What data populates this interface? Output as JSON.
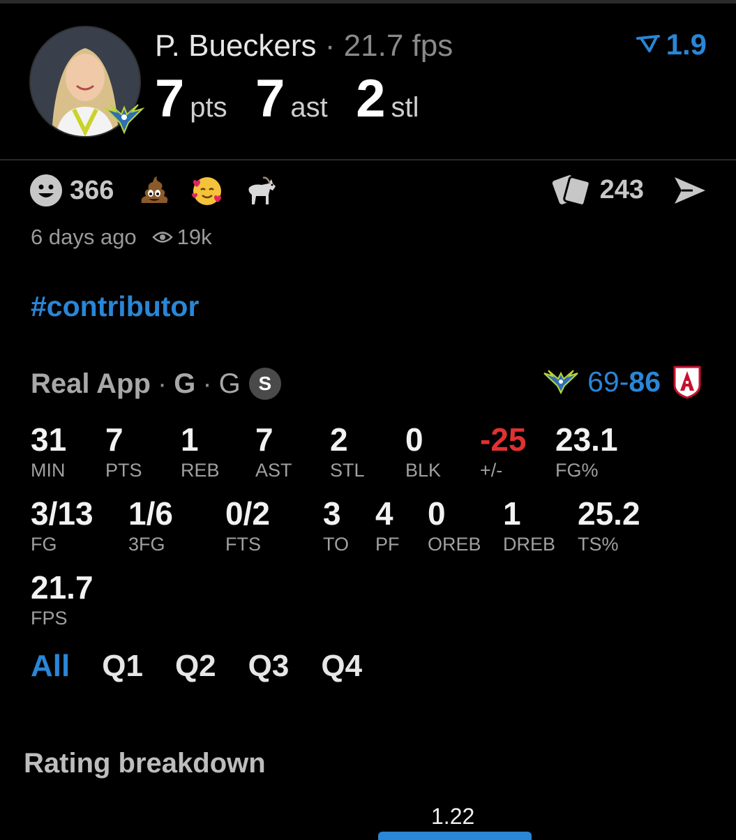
{
  "header": {
    "player_name": "P. Bueckers",
    "separator": "·",
    "fps_text": "21.7 fps",
    "vote_value": "1.9",
    "vote_icon": "chevron-down-icon",
    "stats": [
      {
        "value": "7",
        "unit": "pts"
      },
      {
        "value": "7",
        "unit": "ast"
      },
      {
        "value": "2",
        "unit": "stl"
      }
    ]
  },
  "reactions": {
    "count": "366",
    "items": [
      "poop-emoji",
      "hearts-face-emoji",
      "goat-emoji"
    ],
    "comments_count": "243"
  },
  "meta": {
    "time_ago": "6 days ago",
    "views": "19k"
  },
  "hashtag": "#contributor",
  "game": {
    "source": "Real App",
    "pos1": "G",
    "pos2": "G",
    "badge": "S",
    "score_home": "69",
    "score_dash": "-",
    "score_away": "86",
    "colors": {
      "accent": "#2a86d6",
      "negative": "#e03131"
    }
  },
  "boxscore": [
    {
      "value": "31",
      "label": "MIN"
    },
    {
      "value": "7",
      "label": "PTS"
    },
    {
      "value": "1",
      "label": "REB"
    },
    {
      "value": "7",
      "label": "AST"
    },
    {
      "value": "2",
      "label": "STL"
    },
    {
      "value": "0",
      "label": "BLK"
    },
    {
      "value": "-25",
      "label": "+/-"
    },
    {
      "value": "23.1",
      "label": "FG%"
    },
    {
      "value": "3/13",
      "label": "FG"
    },
    {
      "value": "1/6",
      "label": "3FG"
    },
    {
      "value": "0/2",
      "label": "FTS"
    },
    {
      "value": "3",
      "label": "TO"
    },
    {
      "value": "4",
      "label": "PF"
    },
    {
      "value": "0",
      "label": "OREB"
    },
    {
      "value": "1",
      "label": "DREB"
    },
    {
      "value": "25.2",
      "label": "TS%"
    },
    {
      "value": "21.7",
      "label": "FPS"
    }
  ],
  "tabs": [
    "All",
    "Q1",
    "Q2",
    "Q3",
    "Q4"
  ],
  "rating": {
    "title": "Rating breakdown",
    "value": "1.22"
  }
}
